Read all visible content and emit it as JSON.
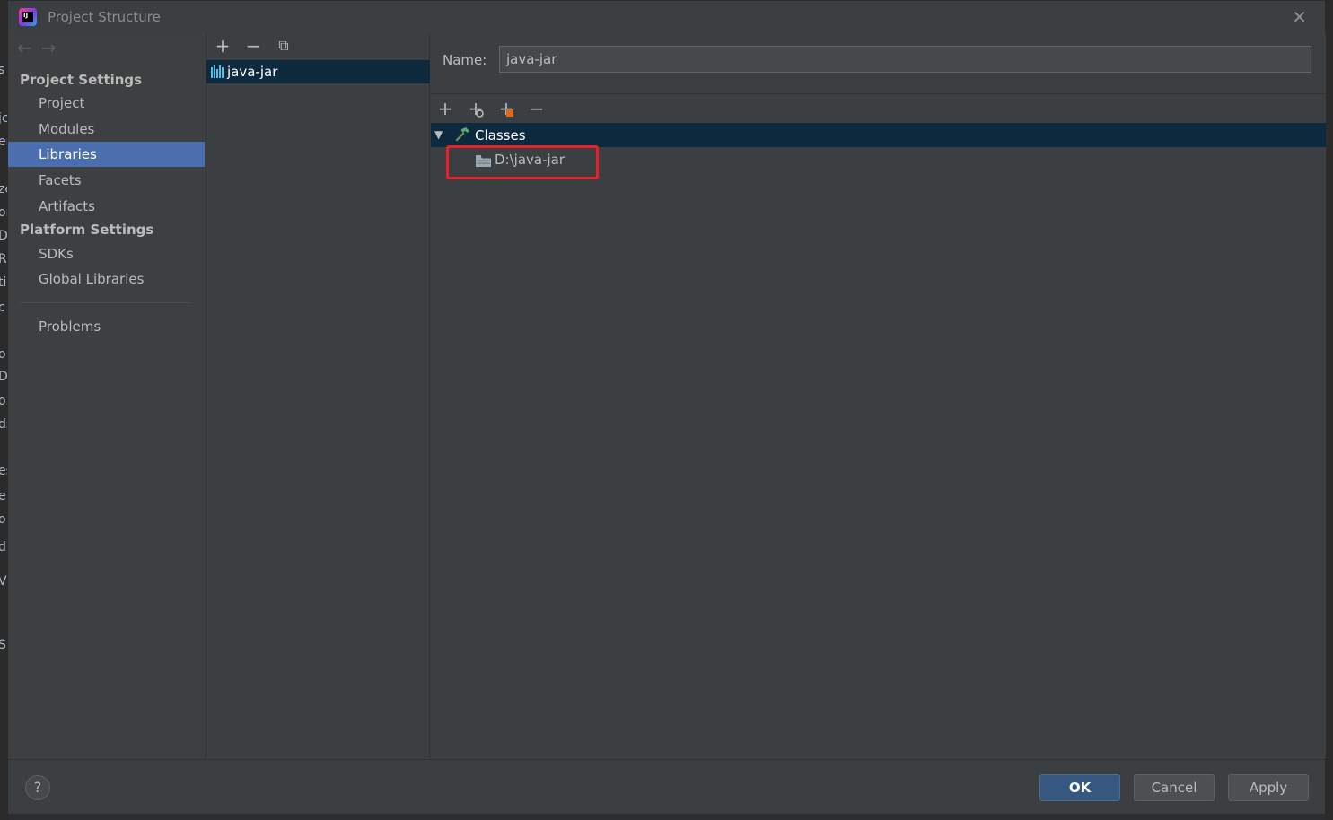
{
  "window": {
    "title": "Project Structure"
  },
  "nav": {
    "project_settings_header": "Project Settings",
    "project_items": [
      {
        "label": "Project"
      },
      {
        "label": "Modules"
      },
      {
        "label": "Libraries",
        "selected": true
      },
      {
        "label": "Facets"
      },
      {
        "label": "Artifacts"
      }
    ],
    "platform_settings_header": "Platform Settings",
    "platform_items": [
      {
        "label": "SDKs"
      },
      {
        "label": "Global Libraries"
      }
    ],
    "problems_label": "Problems"
  },
  "libraries": {
    "toolbar": {
      "add": "+",
      "remove": "−",
      "copy": "⧉"
    },
    "items": [
      {
        "label": "java-jar",
        "selected": true
      }
    ]
  },
  "detail": {
    "name_label": "Name:",
    "name_value": "java-jar",
    "toolbar": {
      "add": "+",
      "add_special": "+",
      "add_alt": "+",
      "remove": "−"
    },
    "tree": {
      "root_label": "Classes",
      "child_label": "D:\\java-jar"
    }
  },
  "footer": {
    "help": "?",
    "ok": "OK",
    "cancel": "Cancel",
    "apply": "Apply"
  },
  "colors": {
    "selection": "#4b6eaf",
    "tree_selection": "#0d293e",
    "highlight_box": "#e8202a"
  },
  "background_editor": {
    "glyphs": [
      "s",
      "je",
      "er",
      "ze",
      "or",
      "De",
      "R",
      "ti",
      "c",
      "o",
      "D",
      "o.",
      "ds",
      "es",
      "e",
      "o",
      "di",
      "V",
      "S"
    ]
  }
}
